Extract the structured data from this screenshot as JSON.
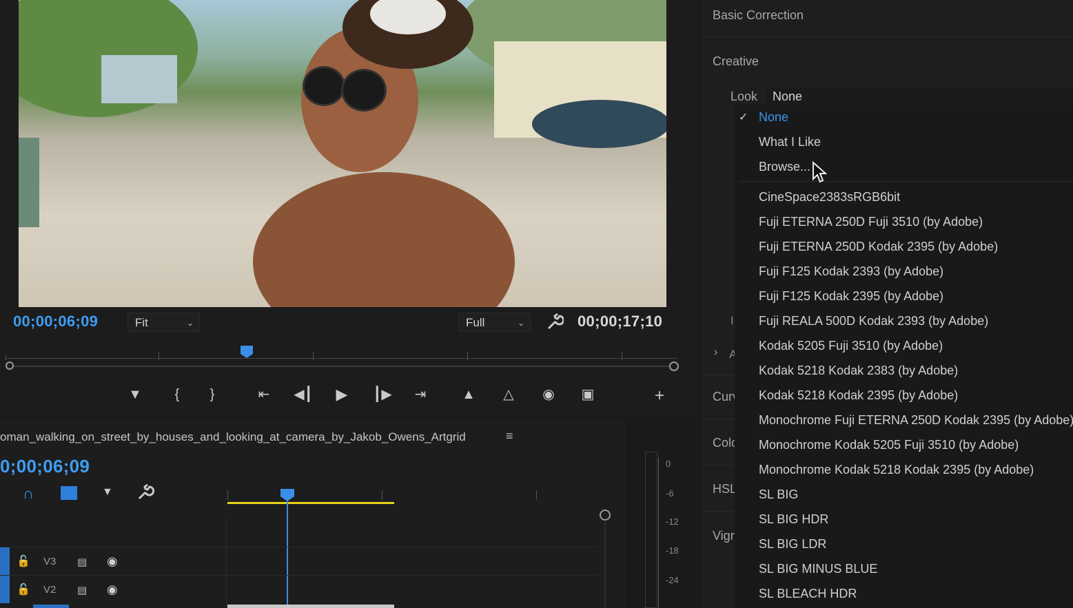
{
  "program_monitor": {
    "current_timecode": "00;00;06;09",
    "fit_option": "Fit",
    "resolution_option": "Full",
    "duration_timecode": "00;00;17;10"
  },
  "timeline": {
    "sequence_name": "oman_walking_on_street_by_houses_and_looking_at_camera_by_Jakob_Owens_Artgrid",
    "timecode": "0;00;06;09",
    "tracks": [
      {
        "label": "V3"
      },
      {
        "label": "V2"
      }
    ]
  },
  "audio_meter": {
    "db_labels": [
      "0",
      "-6",
      "-12",
      "-18",
      "-24"
    ]
  },
  "lumetri": {
    "basic_correction": "Basic Correction",
    "creative": "Creative",
    "look_label": "Look",
    "look_value": "None",
    "partial_labels": {
      "i": "I",
      "a": "A",
      "curves": "Curv",
      "color": "Colo",
      "hsl": "HSL",
      "vignette": "Vign"
    }
  },
  "look_menu": {
    "items": [
      "None",
      "What I Like",
      "Browse...",
      "CineSpace2383sRGB6bit",
      "Fuji ETERNA 250D Fuji 3510 (by Adobe)",
      "Fuji ETERNA 250D Kodak 2395 (by Adobe)",
      "Fuji F125 Kodak 2393 (by Adobe)",
      "Fuji F125 Kodak 2395 (by Adobe)",
      "Fuji REALA 500D Kodak 2393 (by Adobe)",
      "Kodak 5205 Fuji 3510 (by Adobe)",
      "Kodak 5218 Kodak 2383 (by Adobe)",
      "Kodak 5218 Kodak 2395 (by Adobe)",
      "Monochrome Fuji ETERNA 250D Kodak 2395 (by Adobe)",
      "Monochrome Kodak 5205 Fuji 3510 (by Adobe)",
      "Monochrome Kodak 5218 Kodak 2395 (by Adobe)",
      "SL BIG",
      "SL BIG HDR",
      "SL BIG LDR",
      "SL BIG MINUS BLUE",
      "SL BLEACH HDR"
    ],
    "selected_index": 0
  },
  "colors": {
    "accent_blue": "#3b96ee",
    "timecode_blue": "#3d9df3",
    "work_area_yellow": "#e8d21c",
    "panel_bg": "#1e1e1e"
  }
}
